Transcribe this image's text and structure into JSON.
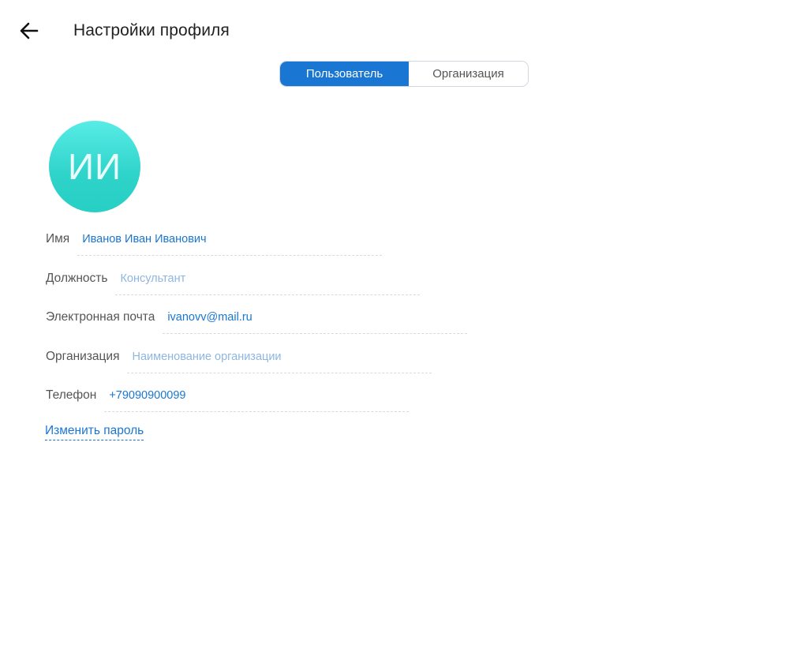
{
  "header": {
    "title": "Настройки профиля",
    "back_icon": "arrow-left-icon"
  },
  "tabs": [
    {
      "label": "Пользователь",
      "active": true
    },
    {
      "label": "Организация",
      "active": false
    }
  ],
  "avatar": {
    "initials": "ИИ"
  },
  "fields": {
    "name": {
      "label": "Имя",
      "value": "Иванов Иван Иванович"
    },
    "position": {
      "label": "Должность",
      "placeholder": "Консультант"
    },
    "email": {
      "label": "Электронная почта",
      "value": "ivanovv@mail.ru"
    },
    "organization": {
      "label": "Организация",
      "placeholder": "Наименование организации"
    },
    "phone": {
      "label": "Телефон",
      "value": "+79090900099"
    }
  },
  "change_password_label": "Изменить пароль",
  "colors": {
    "accent": "#1976d2",
    "avatar_start": "#58ece6",
    "avatar_end": "#27cfc4"
  }
}
